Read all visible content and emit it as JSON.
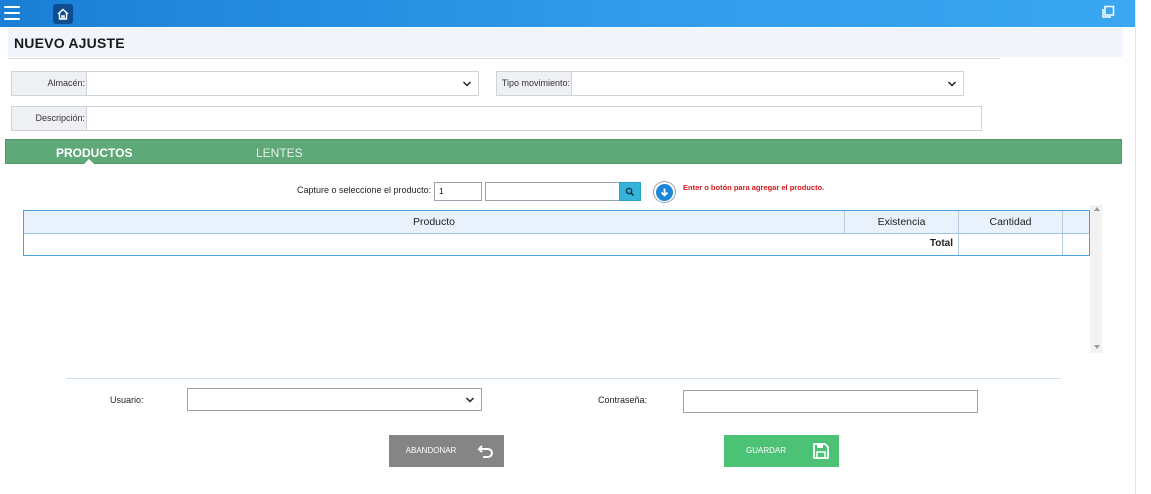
{
  "header": {
    "menu_icon": "hamburger-menu-icon",
    "home_icon": "home-icon",
    "restore_icon": "window-restore-icon"
  },
  "page": {
    "title": "NUEVO AJUSTE"
  },
  "form": {
    "almacen_label": "Almacén:",
    "almacen_value": "",
    "tipo_label": "Tipo movimiento:",
    "tipo_value": "",
    "descripcion_label": "Descripción:",
    "descripcion_value": ""
  },
  "tabs": [
    {
      "label": "PRODUCTOS",
      "active": true
    },
    {
      "label": "LENTES",
      "active": false
    }
  ],
  "capture": {
    "label": "Capture o seleccione el producto:",
    "quantity": "1",
    "product_value": "",
    "hint": "Enter o botón para agregar el producto."
  },
  "grid": {
    "columns": [
      "Producto",
      "Existencia",
      "Cantidad",
      ""
    ],
    "total_label": "Total",
    "total_value": ""
  },
  "footer": {
    "usuario_label": "Usuario:",
    "usuario_value": "",
    "password_label": "Contraseña:",
    "password_value": "",
    "abandon_label": "ABANDONAR",
    "save_label": "GUARDAR"
  },
  "colors": {
    "topbar": "#1a7fd6",
    "tabs": "#5fa978",
    "save": "#4cc276",
    "abandon": "#858585",
    "hint": "#d11a1a"
  }
}
